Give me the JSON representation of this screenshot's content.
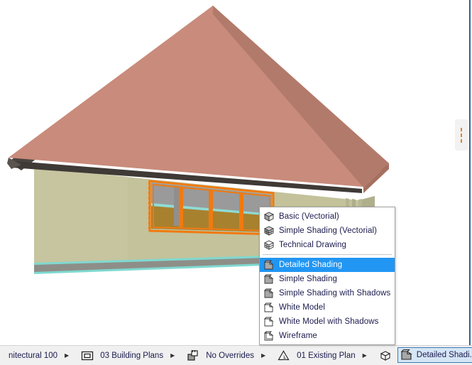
{
  "app": {
    "viewport_name": "3d-model-viewport",
    "model_description": "Architectural 3D model of a single-storey building with a hipped pink roof and a four-pane ribbon window highlighted in orange selection color"
  },
  "colors": {
    "roof_light": "#ca8b7c",
    "roof_mid": "#c08575",
    "roof_dark": "#b07a6d",
    "roof_shadow": "#a5705f",
    "fascia": "#4a4440",
    "wall": "#c3c29b",
    "wall_shade": "#b9b893",
    "foundation": "#8e8e88",
    "selection_orange": "#f07a10",
    "glass": "#9a9a9a",
    "sill_brown": "#a8812f",
    "edge_cyan": "#6fd8d0",
    "menu_highlight": "#2196f3",
    "menu_text": "#1a1a4e",
    "panel_dash": "#e8821e",
    "window_border": "#2a6496"
  },
  "context_menu": {
    "name": "3d-style-context-menu",
    "groups": [
      {
        "items": [
          {
            "label": "Basic (Vectorial)",
            "icon": "cube-vectorial-icon",
            "selected": false
          },
          {
            "label": "Simple Shading (Vectorial)",
            "icon": "brick-vectorial-icon",
            "selected": false
          },
          {
            "label": "Technical Drawing",
            "icon": "brick-technical-icon",
            "selected": false
          }
        ]
      },
      {
        "items": [
          {
            "label": "Detailed Shading",
            "icon": "cube-shaded-icon",
            "selected": true
          },
          {
            "label": "Simple Shading",
            "icon": "cube-shaded-icon",
            "selected": false
          },
          {
            "label": "Simple Shading with Shadows",
            "icon": "cube-shaded-icon",
            "selected": false
          },
          {
            "label": "White Model",
            "icon": "cube-white-icon",
            "selected": false
          },
          {
            "label": "White Model with Shadows",
            "icon": "cube-white-icon",
            "selected": false
          },
          {
            "label": "Wireframe",
            "icon": "cube-wireframe-icon",
            "selected": false
          }
        ]
      }
    ]
  },
  "status_bar": {
    "name": "bottom-status-bar",
    "items": [
      {
        "name": "scale-selector",
        "label": "nitectural 100",
        "icon": null,
        "arrow": true,
        "chip": false
      },
      {
        "name": "layer-combination-selector",
        "label": "03 Building Plans",
        "icon": "layer-combo-icon",
        "arrow": true,
        "chip": false
      },
      {
        "name": "graphic-override-selector",
        "label": "No Overrides",
        "icon": "override-icon",
        "arrow": true,
        "chip": false
      },
      {
        "name": "renovation-filter-selector",
        "label": "01 Existing Plan",
        "icon": "renovation-filter-icon",
        "arrow": true,
        "chip": false
      },
      {
        "name": "3d-style-selector",
        "label": "Detailed Shadi...",
        "icon": "cube-shaded-icon",
        "arrow": true,
        "chip": true
      }
    ]
  },
  "panel_handle": {
    "name": "collapsed-side-panel-handle",
    "dashes": 3
  }
}
